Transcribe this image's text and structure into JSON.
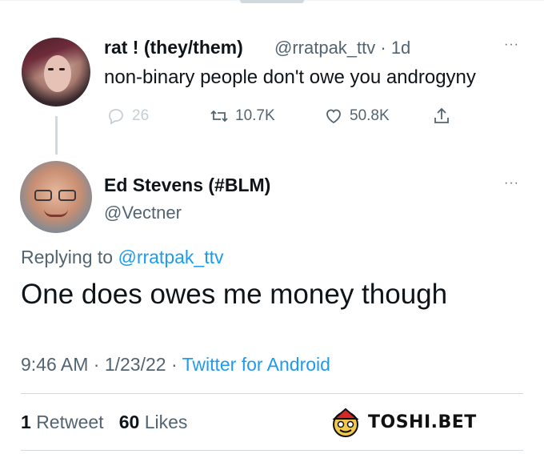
{
  "tweet1": {
    "name": "rat ! (they/them)",
    "handle": "@rratpak_ttv · 1d",
    "text": "non-binary people don't owe you androgyny",
    "replies": "26",
    "retweets": "10.7K",
    "likes": "50.8K",
    "more": "···"
  },
  "tweet2": {
    "name": "Ed Stevens (#BLM)",
    "handle": "@Vectner",
    "more": "···",
    "replying_prefix": "Replying to",
    "replying_handle": "@rratpak_ttv",
    "text": "One does owes me money though",
    "time": "9:46 AM · 1/23/22 · ",
    "source": "Twitter for Android",
    "retweet_count": "1",
    "retweet_label": "Retweet",
    "like_count": "60",
    "like_label": "Likes"
  },
  "watermark": {
    "text": "TOSHI.BET"
  },
  "colors": {
    "accent": "#1d9bf0",
    "secondary_text": "#536471",
    "primary_text": "#0f1419"
  },
  "icons": [
    "reply-icon",
    "retweet-icon",
    "like-icon",
    "share-icon",
    "more-icon"
  ]
}
